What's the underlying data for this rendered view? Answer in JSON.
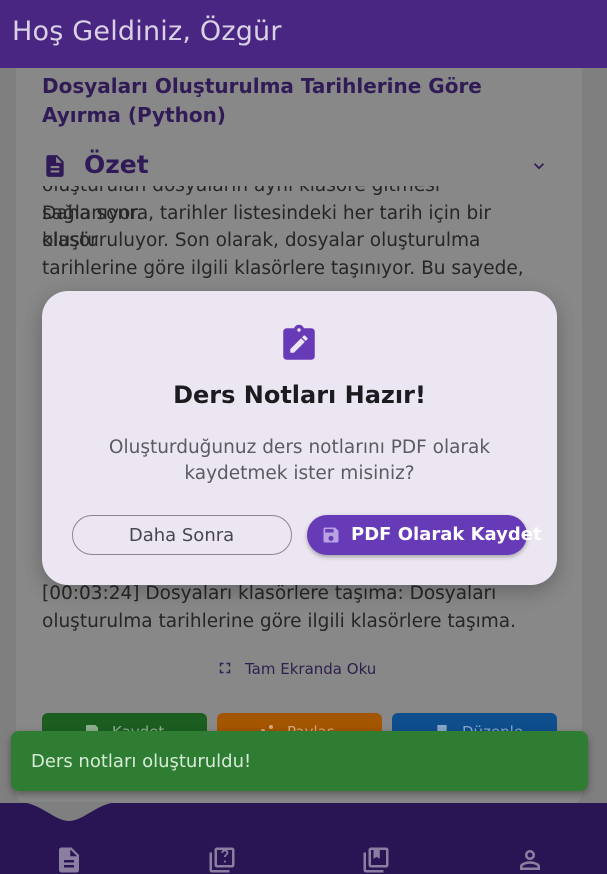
{
  "header": {
    "title": "Hoş Geldiniz, Özgür"
  },
  "note": {
    "title": "Dosyaları Oluşturulma Tarihlerine Göre Ayırma (Python)",
    "section_label": "Özet",
    "summary_lines": [
      "oluşturulan dosyaların aynı klasöre gitmesi sağlanıyor.",
      "Daha sonra, tarihler listesindeki her tarih için bir klasör",
      "oluşturuluyor. Son olarak, dosyalar oluşturulma",
      "tarihlerine göre ilgili klasörlere taşınıyor. Bu sayede,"
    ],
    "transcript_entry": "[00:03:24] Dosyaları klasörlere taşıma: Dosyaları oluşturulma tarihlerine göre ilgili klasörlere taşıma.",
    "fullscreen_label": "Tam Ekranda Oku",
    "actions": [
      {
        "label": "Kaydet",
        "color": "#1b5e20"
      },
      {
        "label": "Paylaş",
        "color": "#a35500"
      },
      {
        "label": "Düzenle",
        "color": "#0e4e8c"
      }
    ]
  },
  "dialog": {
    "icon": "assignment-edit-icon",
    "title": "Ders Notları Hazır!",
    "body": "Oluşturduğunuz ders notlarını PDF olarak kaydetmek ister misiniz?",
    "secondary_label": "Daha Sonra",
    "primary_label": "PDF Olarak Kaydet",
    "primary_color": "#673ab7"
  },
  "snackbar": {
    "message": "Ders notları oluşturuldu!",
    "color": "#2e7d32"
  },
  "bottom_nav": {
    "items": [
      {
        "icon": "notes-icon",
        "active": true
      },
      {
        "icon": "quiz-icon",
        "active": false
      },
      {
        "icon": "library-icon",
        "active": false
      },
      {
        "icon": "profile-icon",
        "active": false
      }
    ]
  },
  "colors": {
    "brand": "#4a2683",
    "accent": "#673ab7"
  }
}
